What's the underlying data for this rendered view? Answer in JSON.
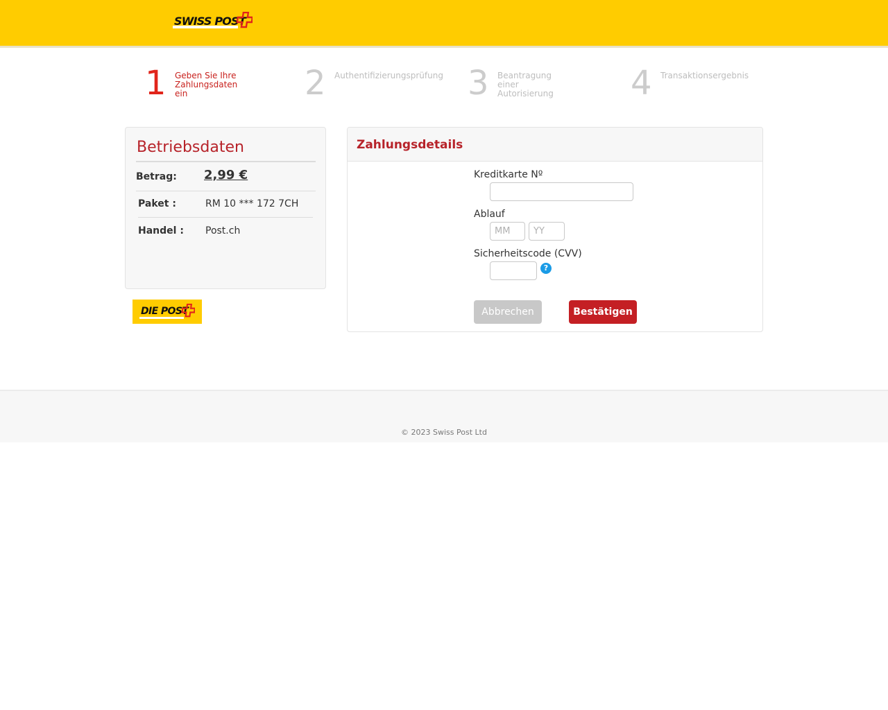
{
  "header": {
    "logo_text": "SWISS POST",
    "brand_color": "#ffcc00",
    "cross_color": "#e1251b"
  },
  "steps": [
    {
      "number": "1",
      "label": "Geben Sie Ihre Zahlungsdaten ein",
      "active": true
    },
    {
      "number": "2",
      "label": "Authentifizierungsprüfung",
      "active": false
    },
    {
      "number": "3",
      "label": "Beantragung einer Autorisierung",
      "active": false
    },
    {
      "number": "4",
      "label": "Transaktionsergebnis",
      "active": false
    }
  ],
  "business": {
    "title": "Betriebsdaten",
    "amount_label": "Betrag:",
    "amount_value": "2,99 €",
    "paket_label": "Paket :",
    "paket_value": "RM 10 *** 172 7CH",
    "handel_label": "Handel :",
    "handel_value": "Post.ch"
  },
  "diepost_logo_text": "DIE POST",
  "payment": {
    "title": "Zahlungsdetails",
    "card_label": "Kreditkarte Nº",
    "card_value": "",
    "expiry_label": "Ablauf",
    "month_placeholder": "MM",
    "year_placeholder": "YY",
    "cvv_label": "Sicherheitscode (CVV)",
    "cvv_value": "",
    "help_symbol": "?",
    "cancel_label": "Abbrechen",
    "confirm_label": "Bestätigen",
    "accent_color": "#b7232a"
  },
  "footer": {
    "copyright": "© 2023 Swiss Post Ltd"
  }
}
